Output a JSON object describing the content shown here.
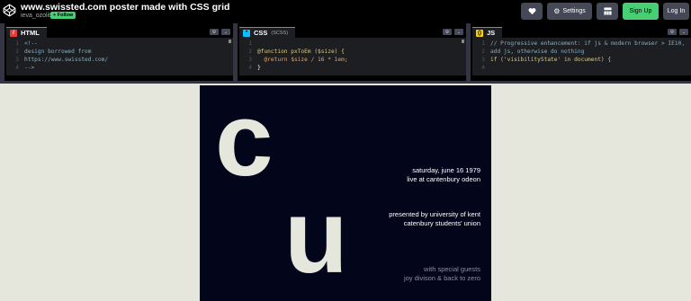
{
  "header": {
    "title": "www.swissted.com poster made with CSS grid",
    "author": "ieva_ozolite",
    "follow_label": "+ Follow",
    "buttons": {
      "love_icon": "heart-icon",
      "settings_label": "Settings",
      "layout_icon": "layout-icon",
      "signup_label": "Sign Up",
      "login_label": "Log In"
    }
  },
  "editors": {
    "html": {
      "name": "HTML",
      "icon_color": "#e73c3c",
      "lines": [
        {
          "num": "1",
          "text": "<!--"
        },
        {
          "num": "2",
          "text": "design borrowed from"
        },
        {
          "num": "3",
          "text": "https://www.swissted.com/"
        },
        {
          "num": "4",
          "text": "-->"
        }
      ]
    },
    "css": {
      "name": "CSS",
      "sub": "(SCSS)",
      "icon_color": "#0ebeff",
      "lines": [
        {
          "num": "1",
          "text": ""
        },
        {
          "num": "2",
          "text": "@function pxToEm ($size) {"
        },
        {
          "num": "3",
          "text": "  @return $size / 16 * 1em;"
        },
        {
          "num": "4",
          "text": "}"
        }
      ]
    },
    "js": {
      "name": "JS",
      "icon_color": "#fcd000",
      "lines": [
        {
          "num": "1",
          "text": "// Progressive enhancement: if js & modern browser > IE10,"
        },
        {
          "num": "2",
          "text": "add js, otherwise do nothing"
        },
        {
          "num": "3",
          "text": "if ('visibilityState' in document) {"
        },
        {
          "num": "4",
          "text": ""
        }
      ]
    }
  },
  "poster": {
    "letter_top": "c",
    "letter_bottom": "u",
    "date_line1": "saturday, june 16 1979",
    "date_line2": "live at cantenbury odeon",
    "presenter_line1": "presented by university of kent",
    "presenter_line2": "catenbury students' union",
    "guests_line1": "with special guests",
    "guests_line2": "joy divison & back to zero"
  },
  "colors": {
    "poster_bg": "#03051a",
    "page_bg": "#e5e7dd",
    "accent_green": "#47cf73"
  }
}
